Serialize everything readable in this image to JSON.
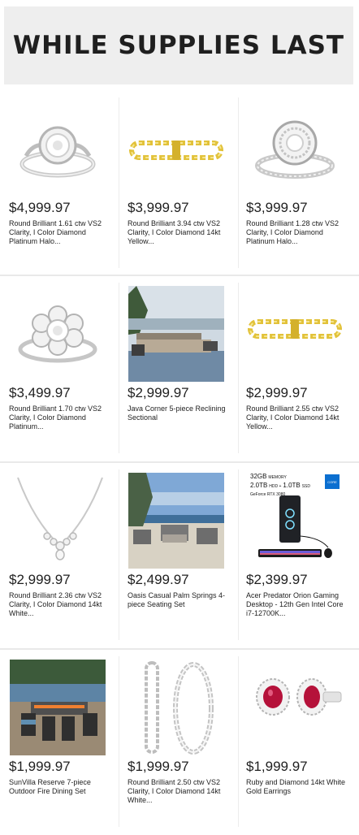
{
  "banner": {
    "title": "WHILE SUPPLIES LAST"
  },
  "products": [
    {
      "price": "$4,999.97",
      "title": "Round Brilliant 1.61 ctw VS2 Clarity, I Color Diamond Platinum Halo...",
      "icon": "halo-ring-icon"
    },
    {
      "price": "$3,999.97",
      "title": "Round Brilliant 3.94 ctw VS2 Clarity, I Color Diamond 14kt Yellow...",
      "icon": "gold-bracelet-icon"
    },
    {
      "price": "$3,999.97",
      "title": "Round Brilliant 1.28 ctw VS2 Clarity, I Color Diamond Platinum Halo...",
      "icon": "halo-ring-icon"
    },
    {
      "price": "$3,499.97",
      "title": "Round Brilliant 1.70 ctw VS2 Clarity, I Color Diamond Platinum...",
      "icon": "flower-ring-icon"
    },
    {
      "price": "$2,999.97",
      "title": "Java Corner 5-piece Reclining Sectional",
      "icon": "sectional-photo-icon"
    },
    {
      "price": "$2,999.97",
      "title": "Round Brilliant 2.55 ctw VS2 Clarity, I Color Diamond 14kt Yellow...",
      "icon": "gold-bracelet-icon"
    },
    {
      "price": "$2,999.97",
      "title": "Round Brilliant 2.36 ctw VS2 Clarity, I Color Diamond 14kt White...",
      "icon": "necklace-icon"
    },
    {
      "price": "$2,499.97",
      "title": "Oasis Casual Palm Springs 4-piece Seating Set",
      "icon": "patio-photo-icon"
    },
    {
      "price": "$2,399.97",
      "title": "Acer Predator Orion Gaming Desktop - 12th Gen Intel Core i7-12700K...",
      "icon": "gaming-pc-icon",
      "spec": {
        "memory": "32GB",
        "memory_label": "MEMORY",
        "storage": "2.0TB",
        "hdd_label": "HDD +",
        "ssd": "1.0TB",
        "ssd_label": "SSD",
        "gpu": "GeForce RTX 3080",
        "cpu_badge": "CORE"
      }
    },
    {
      "price": "$1,999.97",
      "title": "SunVilla Reserve 7-piece Outdoor Fire Dining Set",
      "icon": "dining-photo-icon"
    },
    {
      "price": "$1,999.97",
      "title": "Round Brilliant 2.50 ctw VS2 Clarity, I Color Diamond 14kt White...",
      "icon": "hoop-earrings-icon"
    },
    {
      "price": "$1,999.97",
      "title": "Ruby and Diamond 14kt White Gold Earrings",
      "icon": "ruby-earrings-icon"
    }
  ],
  "colors": {
    "banner_bg": "#eeeeee",
    "gold": "#e2c23a",
    "ruby": "#b5123a"
  }
}
